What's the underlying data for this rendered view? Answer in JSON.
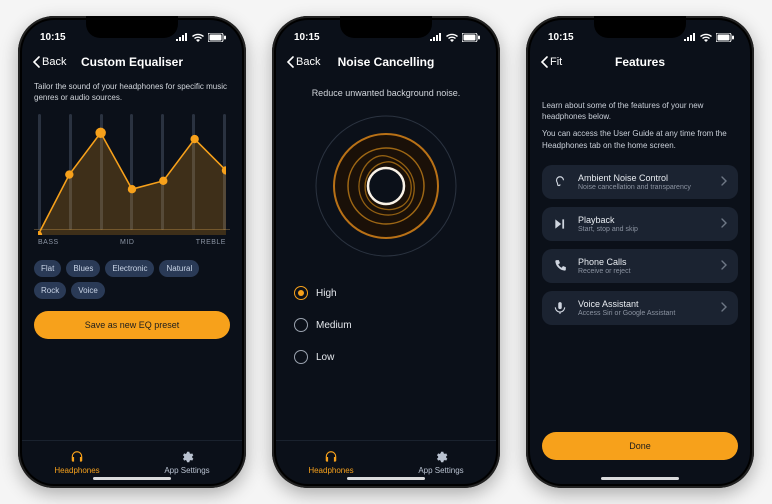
{
  "common": {
    "time": "10:15",
    "back_label": "Back",
    "tab_headphones": "Headphones",
    "tab_settings": "App Settings"
  },
  "screen1": {
    "title": "Custom Equaliser",
    "subtitle": "Tailor the sound of your headphones for specific music genres or audio sources.",
    "labels": {
      "bass": "BASS",
      "mid": "MID",
      "treble": "TREBLE"
    },
    "presets": [
      "Flat",
      "Blues",
      "Electronic",
      "Natural",
      "Rock",
      "Voice"
    ],
    "save_label": "Save as new EQ preset"
  },
  "screen2": {
    "title": "Noise Cancelling",
    "subtitle": "Reduce unwanted background noise.",
    "options": {
      "high": "High",
      "medium": "Medium",
      "low": "Low"
    },
    "selected": "high"
  },
  "screen3": {
    "back_label": "Fit",
    "title": "Features",
    "desc1": "Learn about some of the features of your new headphones below.",
    "desc2": "You can access the User Guide at any time from the Headphones tab on the home screen.",
    "cards": {
      "anc": {
        "title": "Ambient Noise Control",
        "sub": "Noise cancellation and transparency"
      },
      "playback": {
        "title": "Playback",
        "sub": "Start, stop and skip"
      },
      "calls": {
        "title": "Phone Calls",
        "sub": "Receive or reject"
      },
      "voice": {
        "title": "Voice Assistant",
        "sub": "Access Siri or Google Assistant"
      }
    },
    "done_label": "Done"
  }
}
